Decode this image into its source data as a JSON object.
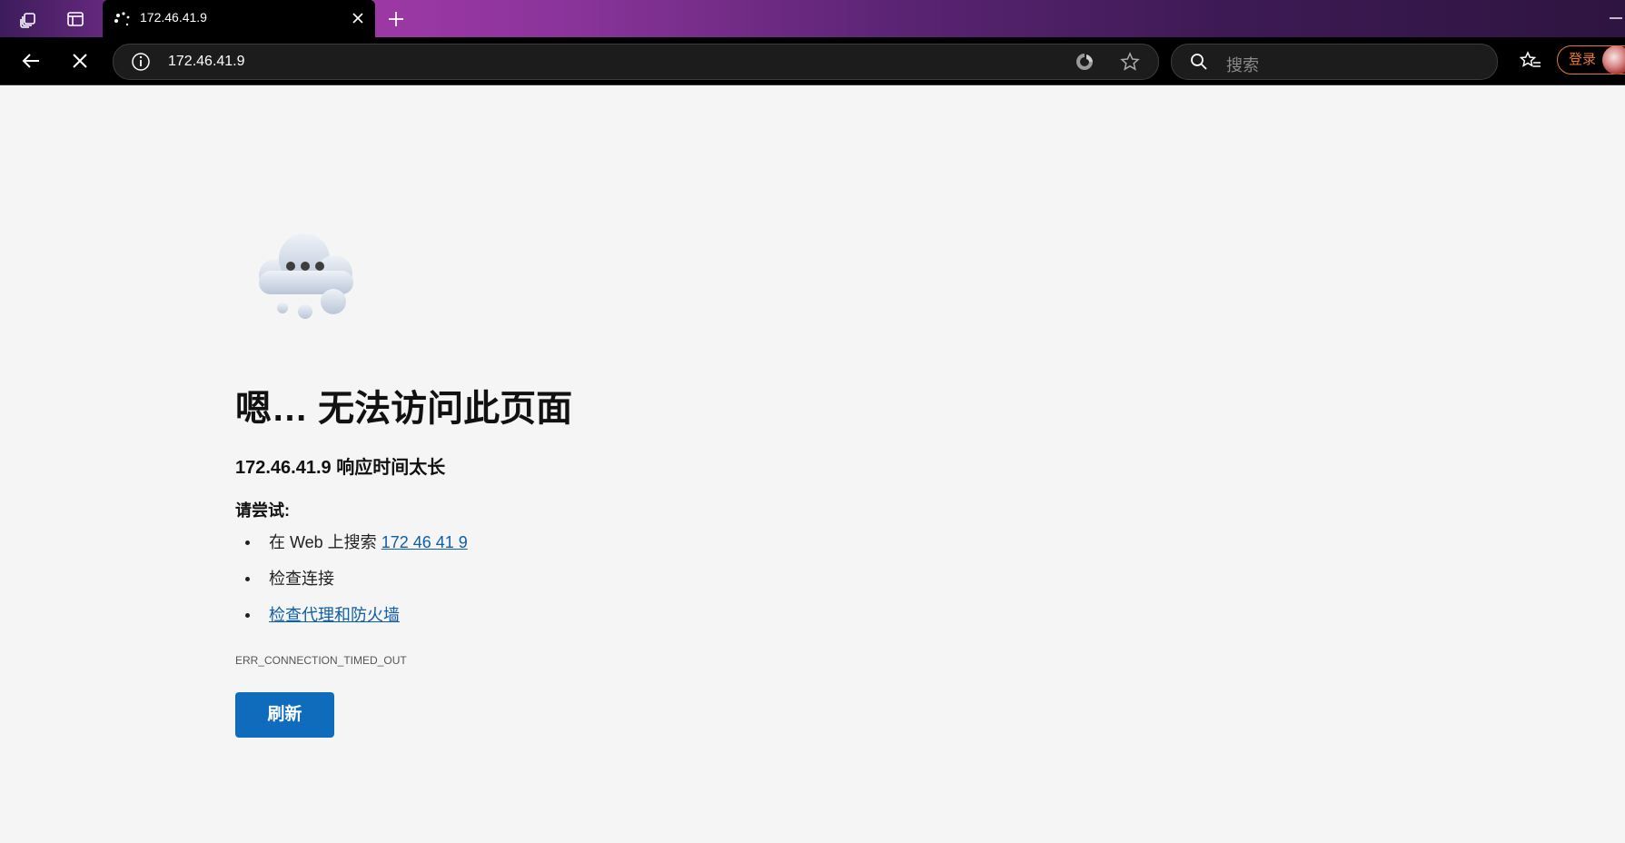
{
  "browser": {
    "tab": {
      "title": "172.46.41.9"
    },
    "address": {
      "url": "172.46.41.9"
    },
    "search": {
      "placeholder": "搜索"
    },
    "login_label": "登录"
  },
  "error_page": {
    "headline": "嗯… 无法访问此页面",
    "subline": "172.46.41.9 响应时间太长",
    "try_label": "请尝试:",
    "suggestions": {
      "search_prefix": "在 Web 上搜索 ",
      "search_link": "172 46 41 9",
      "check_connection": "检查连接",
      "check_proxy": "检查代理和防火墙"
    },
    "error_code": "ERR_CONNECTION_TIMED_OUT",
    "refresh_label": "刷新"
  },
  "colors": {
    "accent": "#0f6cbd",
    "link": "#0f5ea8",
    "login": "#e77a2e"
  },
  "icons": [
    "workspaces-icon",
    "tab-actions-icon",
    "loading-icon",
    "close-icon",
    "plus-icon",
    "minimize-icon",
    "back-icon",
    "stop-icon",
    "info-icon",
    "edge-refresh-icon",
    "star-icon",
    "search-icon",
    "favorites-icon",
    "cloud-icon"
  ]
}
